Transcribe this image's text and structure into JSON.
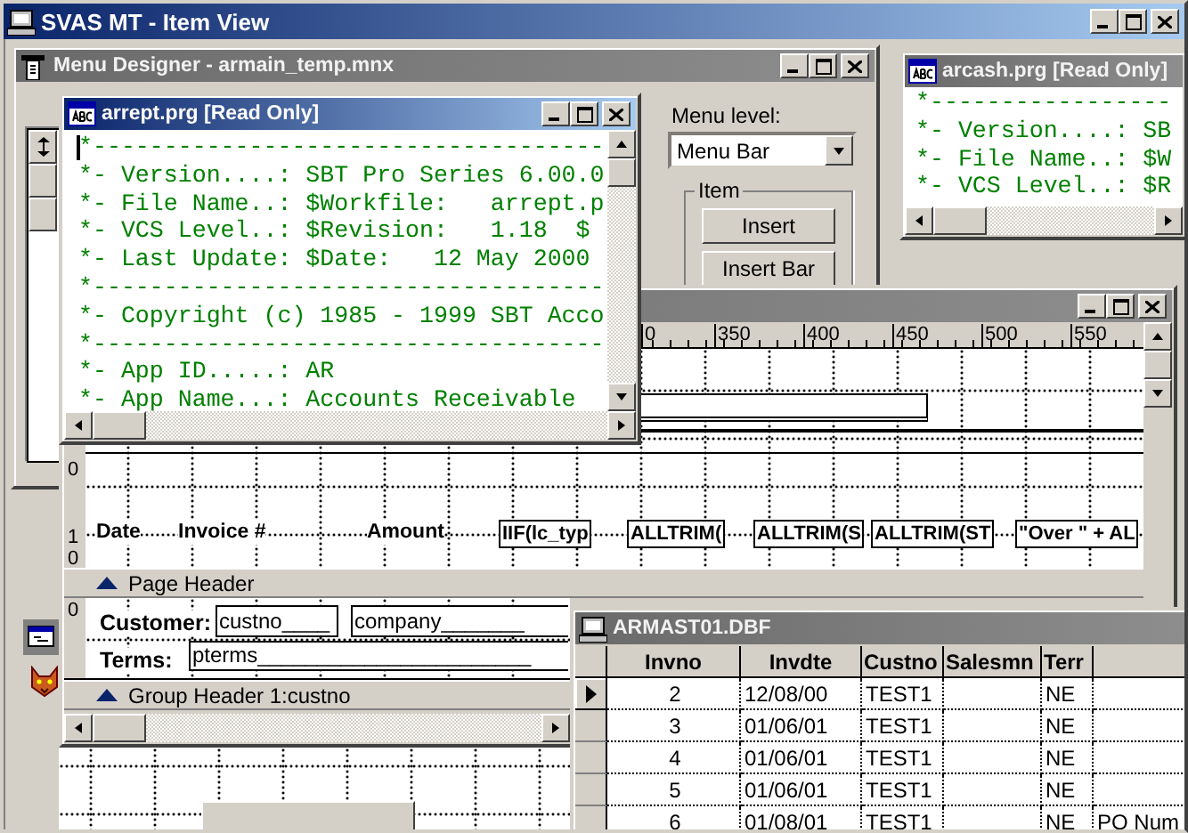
{
  "app_window": {
    "title": "SVAS MT - Item View"
  },
  "menu_designer": {
    "title": "Menu Designer - armain_temp.mnx",
    "active": false,
    "menu_level_label": "Menu level:",
    "menu_level": "Menu Bar",
    "item_group": "Item",
    "buttons": [
      "Insert",
      "Insert Bar"
    ]
  },
  "code_windows": [
    {
      "title": "arrept.prg [Read Only]",
      "active": true,
      "lines": [
        "*------------------------------------",
        "*- Version....: SBT Pro Series 6.00.0",
        "*- File Name..: $Workfile:   arrept.p",
        "*- VCS Level..: $Revision:   1.18  $",
        "*- Last Update: $Date:   12 May 2000",
        "*------------------------------------",
        "*- Copyright (c) 1985 - 1999 SBT Acco",
        "*------------------------------------",
        "*- App ID.....: AR",
        "*- App Name...: Accounts Receivable"
      ]
    },
    {
      "title": "arcash.prg [Read Only]",
      "active": false,
      "lines": [
        "*-----------------",
        "*- Version....: SB",
        "*- File Name..: $W",
        "*- VCS Level..: $R"
      ]
    }
  ],
  "report_designer": {
    "active": false,
    "ruler": [
      "0",
      "350",
      "400",
      "450",
      "500",
      "550"
    ],
    "detail_ruler": [
      "0",
      "1",
      "0"
    ],
    "detail_items": [
      {
        "kind": "label",
        "text": "Date"
      },
      {
        "kind": "label",
        "text": "Invoice #"
      },
      {
        "kind": "label",
        "text": "Amount"
      },
      {
        "kind": "field",
        "text": "IIF(lc_typ"
      },
      {
        "kind": "field",
        "text": "ALLTRIM("
      },
      {
        "kind": "field",
        "text": "ALLTRIM(S"
      },
      {
        "kind": "field",
        "text": "ALLTRIM(ST"
      },
      {
        "kind": "field",
        "text": "\"Over \" + AL"
      }
    ],
    "bands": [
      "Page Header",
      "Group Header 1:custno"
    ],
    "group_ruler": [
      "0"
    ],
    "group_items": [
      {
        "kind": "label",
        "text": "Customer:"
      },
      {
        "kind": "field",
        "text": "custno____"
      },
      {
        "kind": "field",
        "text": "company_______"
      },
      {
        "kind": "label",
        "text": "Terms:"
      },
      {
        "kind": "field",
        "text": "pterms_______________________"
      }
    ]
  },
  "table_window": {
    "title": "ARMAST01.DBF",
    "active": false,
    "columns": [
      "Invno",
      "Invdte",
      "Custno",
      "Salesmn",
      "Terr"
    ],
    "rows": [
      {
        "invno": "2",
        "invdte": "12/08/00",
        "custno": "TEST1",
        "terr": "NE",
        "selected": true
      },
      {
        "invno": "3",
        "invdte": "01/06/01",
        "custno": "TEST1",
        "terr": "NE",
        "selected": false
      },
      {
        "invno": "4",
        "invdte": "01/06/01",
        "custno": "TEST1",
        "terr": "NE",
        "selected": false
      },
      {
        "invno": "5",
        "invdte": "01/06/01",
        "custno": "TEST1",
        "terr": "NE",
        "selected": false
      },
      {
        "invno": "6",
        "invdte": "01/08/01",
        "custno": "TEST1",
        "terr": "NE",
        "column_6": "PO Num",
        "selected": false
      }
    ]
  }
}
